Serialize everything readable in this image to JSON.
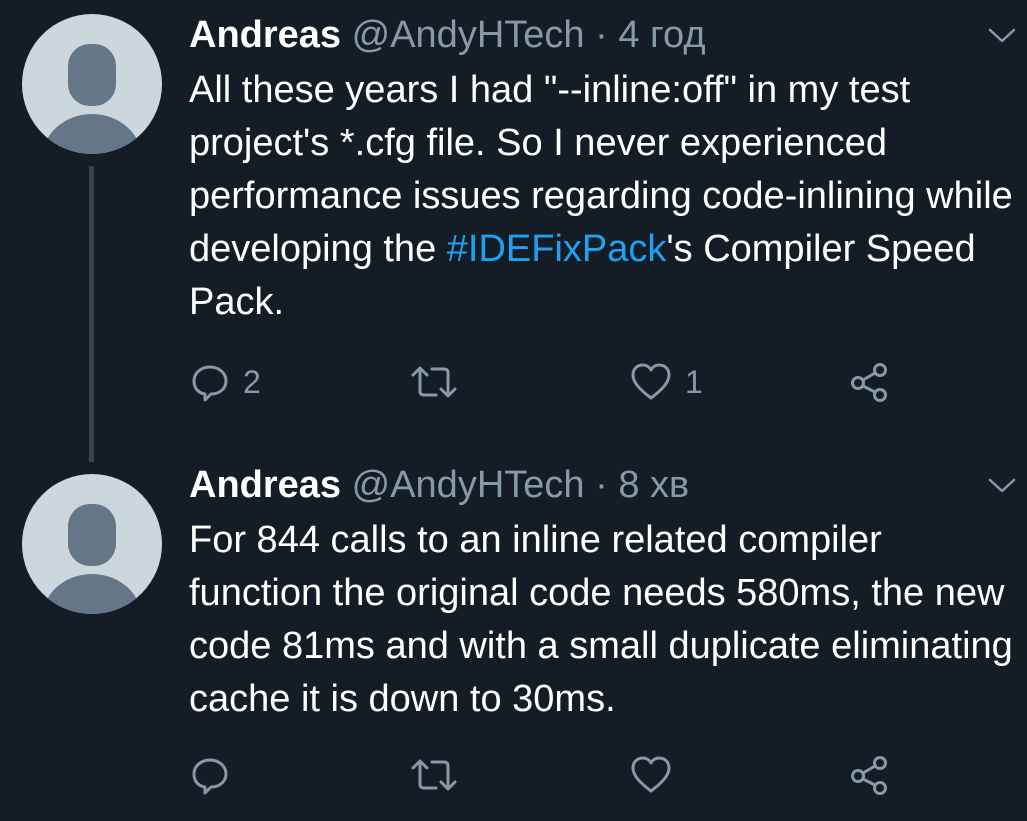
{
  "tweets": [
    {
      "author_name": "Andreas",
      "handle": "@AndyHTech",
      "separator": "·",
      "time": "4 год",
      "text_before": "All these years I had \"--inline:off\" in my test project's *.cfg file. So I never experienced performance issues regarding code-inlining while developing the ",
      "hashtag": "#IDEFixPack",
      "text_after": "'s Compiler Speed Pack.",
      "reply_count": "2",
      "retweet_count": "",
      "like_count": "1"
    },
    {
      "author_name": "Andreas",
      "handle": "@AndyHTech",
      "separator": "·",
      "time": "8 хв",
      "text": "For 844 calls to an inline related compiler function the original code needs 580ms, the new code 81ms and with a small duplicate eliminating cache it is down to 30ms.",
      "reply_count": "",
      "retweet_count": "",
      "like_count": ""
    }
  ],
  "colors": {
    "background": "#141d26",
    "text": "#ffffff",
    "secondary": "#8899a6",
    "link": "#1da1f2",
    "avatar_bg": "#ccd6dd",
    "avatar_fg": "#657786",
    "thread_line": "#38444d"
  },
  "icons": [
    "avatar-placeholder",
    "caret-down-icon",
    "reply-icon",
    "retweet-icon",
    "like-icon",
    "share-icon"
  ]
}
